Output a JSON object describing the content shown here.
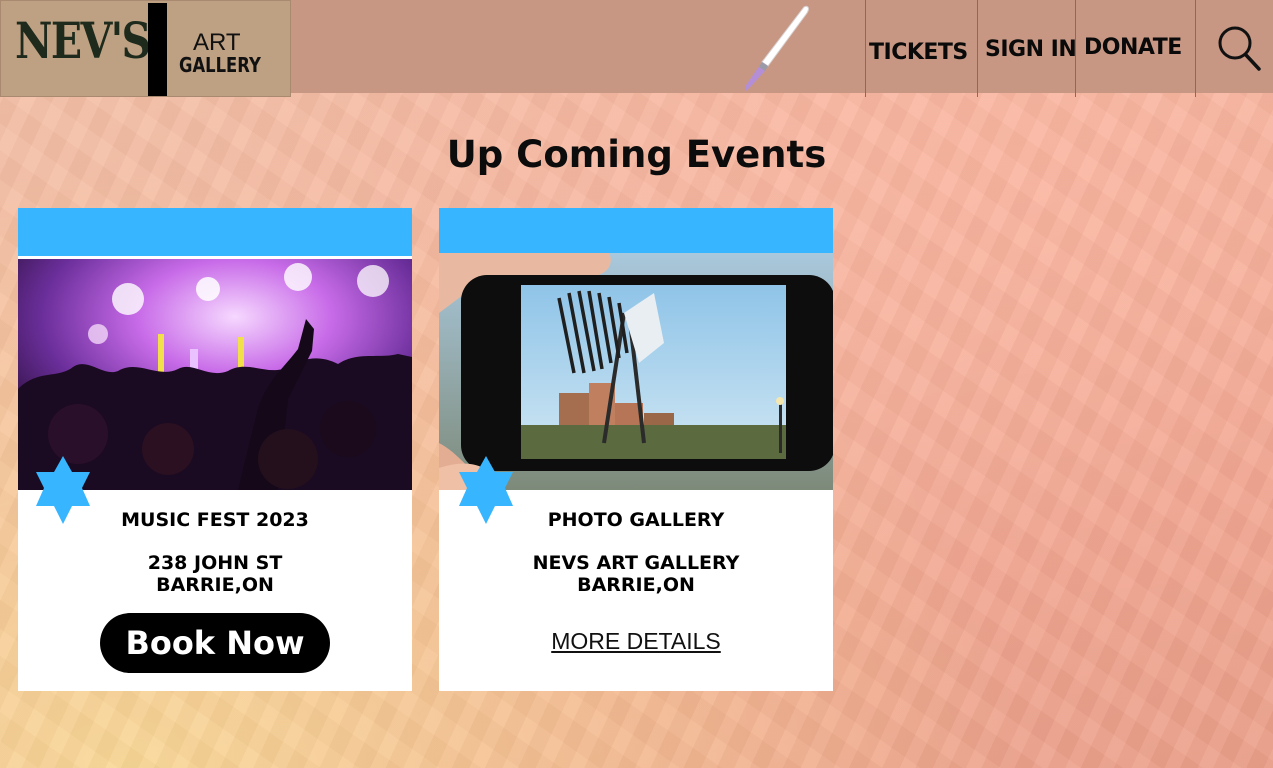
{
  "header": {
    "logo_main": "NEV'S",
    "logo_line1": "ART",
    "logo_line2": "GALLERY",
    "nav": [
      "TICKETS",
      "SIGN IN",
      "DONATE"
    ]
  },
  "page": {
    "title": "Up Coming Events"
  },
  "events": [
    {
      "title": "MUSIC FEST 2023",
      "address_line1": "238 JOHN ST",
      "address_line2": "BARRIE,ON",
      "action": "Book Now"
    },
    {
      "title": "PHOTO GALLERY",
      "address_line1": "NEVS ART GALLERY",
      "address_line2": "BARRIE,ON",
      "action": "MORE DETAILS"
    }
  ],
  "colors": {
    "header_bg": "#c79784",
    "accent_blue": "#37b5ff",
    "button_bg": "#000000"
  },
  "icons": [
    "paintbrush-icon",
    "search-icon",
    "star-badge-icon"
  ]
}
